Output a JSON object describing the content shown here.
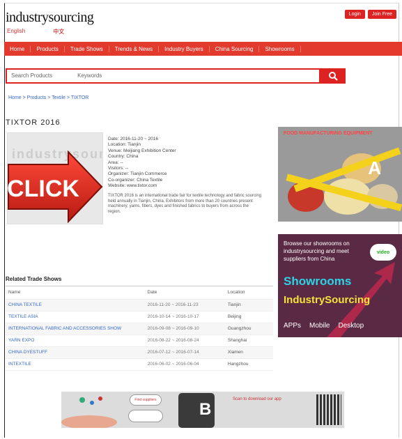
{
  "header": {
    "logo": "industrysourcing",
    "lang_left": "English",
    "lang_right": "中文",
    "btn_login": "Login",
    "btn_join": "Join Free"
  },
  "nav": {
    "items": [
      "Home",
      "Products",
      "Trade Shows",
      "Trends & News",
      "Industry Buyers",
      "China Sourcing",
      "Showrooms"
    ]
  },
  "search": {
    "category": "Search Products",
    "placeholder": "Keywords"
  },
  "breadcrumb": "Home > Products > Textile > TIXTOR",
  "product": {
    "title": "TIXTOR 2016",
    "info_lines": [
      "Date: 2016-11-20 ~ 2016",
      "Location: Tianjin",
      "Venue: Meijiang Exhibition Center",
      "Country: China",
      "Area: --",
      "Visitors: --",
      "Organizer: Tianjin Commerce",
      "Co-organizer: China Textile",
      "Website: www.tixtor.com"
    ],
    "description": "TIXTOR 2016 is an international trade fair for textile technology and fabric sourcing held annually in Tianjin, China. Exhibitors from more than 20 countries present machinery, yarns, fibers, dyes and finished fabrics to buyers from across the region.",
    "watermark": "industrysourcing",
    "click_label": "CLICK"
  },
  "ad_a": {
    "title": "FOOD MANUFACTURING EQUIPMENT",
    "label": "A"
  },
  "ad_showroom": {
    "headline": "Browse our showrooms on industrysourcing and meet suppliers from China",
    "badge": "video",
    "title1": "Showrooms",
    "title2": "IndustrySourcing",
    "footer": [
      "APPs",
      "Mobile",
      "Desktop"
    ]
  },
  "related": {
    "title": "Related Trade Shows",
    "columns": [
      "Name",
      "Date",
      "Location"
    ],
    "rows": [
      [
        "CHINA TEXTILE",
        "2016-11-20 ~ 2016-11-23",
        "Tianjin"
      ],
      [
        "TEXTILE ASIA",
        "2016-10-14 ~ 2016-10-17",
        "Beijing"
      ],
      [
        "INTERNATIONAL FABRIC AND ACCESSORIES SHOW",
        "2016-09-08 ~ 2016-09-10",
        "Guangzhou"
      ],
      [
        "YARN EXPO",
        "2016-08-22 ~ 2016-08-24",
        "Shanghai"
      ],
      [
        "CHINA DYESTUFF",
        "2016-07-12 ~ 2016-07-14",
        "Xiamen"
      ],
      [
        "INTEXTILE",
        "2016-06-02 ~ 2016-06-04",
        "Hangzhou"
      ]
    ]
  },
  "ad_b": {
    "label": "B",
    "text": "Scan to download our app",
    "bubble": "Find suppliers"
  },
  "colors": {
    "accent": "#e23b2e",
    "link": "#3366cc"
  }
}
